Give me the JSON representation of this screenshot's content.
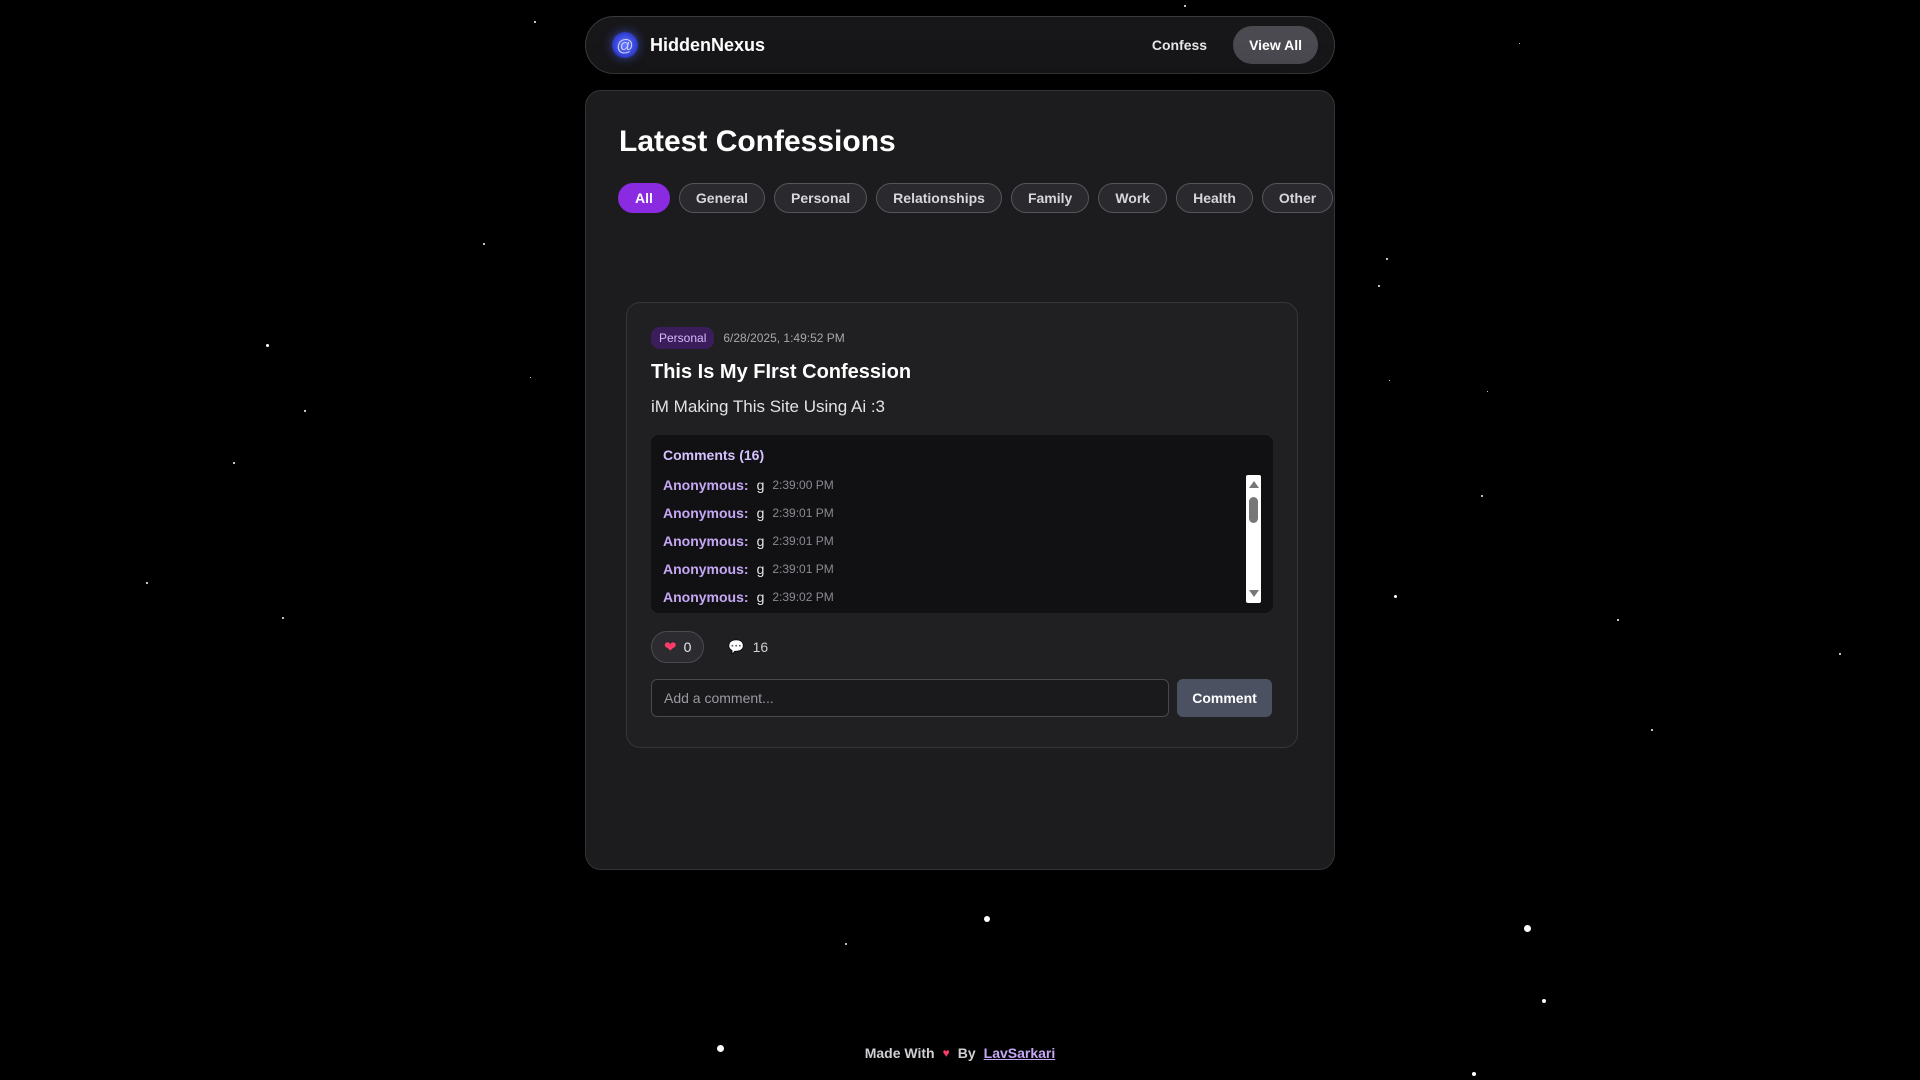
{
  "nav": {
    "brand_name": "HiddenNexus",
    "brand_icon": "spiral-icon",
    "links": [
      {
        "label": "Confess"
      },
      {
        "label": "View All"
      }
    ]
  },
  "main": {
    "title": "Latest Confessions",
    "filters": [
      "All",
      "General",
      "Personal",
      "Relationships",
      "Family",
      "Work",
      "Health",
      "Other"
    ],
    "active_filter": "All"
  },
  "confession": {
    "category": "Personal",
    "date": "6/28/2025, 1:49:52 PM",
    "title": "This Is My FIrst Confession",
    "body": "iM Making This Site Using Ai :3",
    "comments_header": "Comments (16)",
    "comments": [
      {
        "author": "Anonymous:",
        "text": "g",
        "time": "2:39:00 PM"
      },
      {
        "author": "Anonymous:",
        "text": "g",
        "time": "2:39:01 PM"
      },
      {
        "author": "Anonymous:",
        "text": "g",
        "time": "2:39:01 PM"
      },
      {
        "author": "Anonymous:",
        "text": "g",
        "time": "2:39:01 PM"
      },
      {
        "author": "Anonymous:",
        "text": "g",
        "time": "2:39:02 PM"
      }
    ],
    "likes": "0",
    "comment_count": "16",
    "comment_placeholder": "Add a comment...",
    "comment_button": "Comment"
  },
  "footer": {
    "made_with": "Made With",
    "heart": "♥",
    "by": "By",
    "author": "LavSarkari"
  },
  "colors": {
    "accent": "#8a2be2",
    "heart": "#ff3b6b",
    "author": "#c5a8f5"
  }
}
